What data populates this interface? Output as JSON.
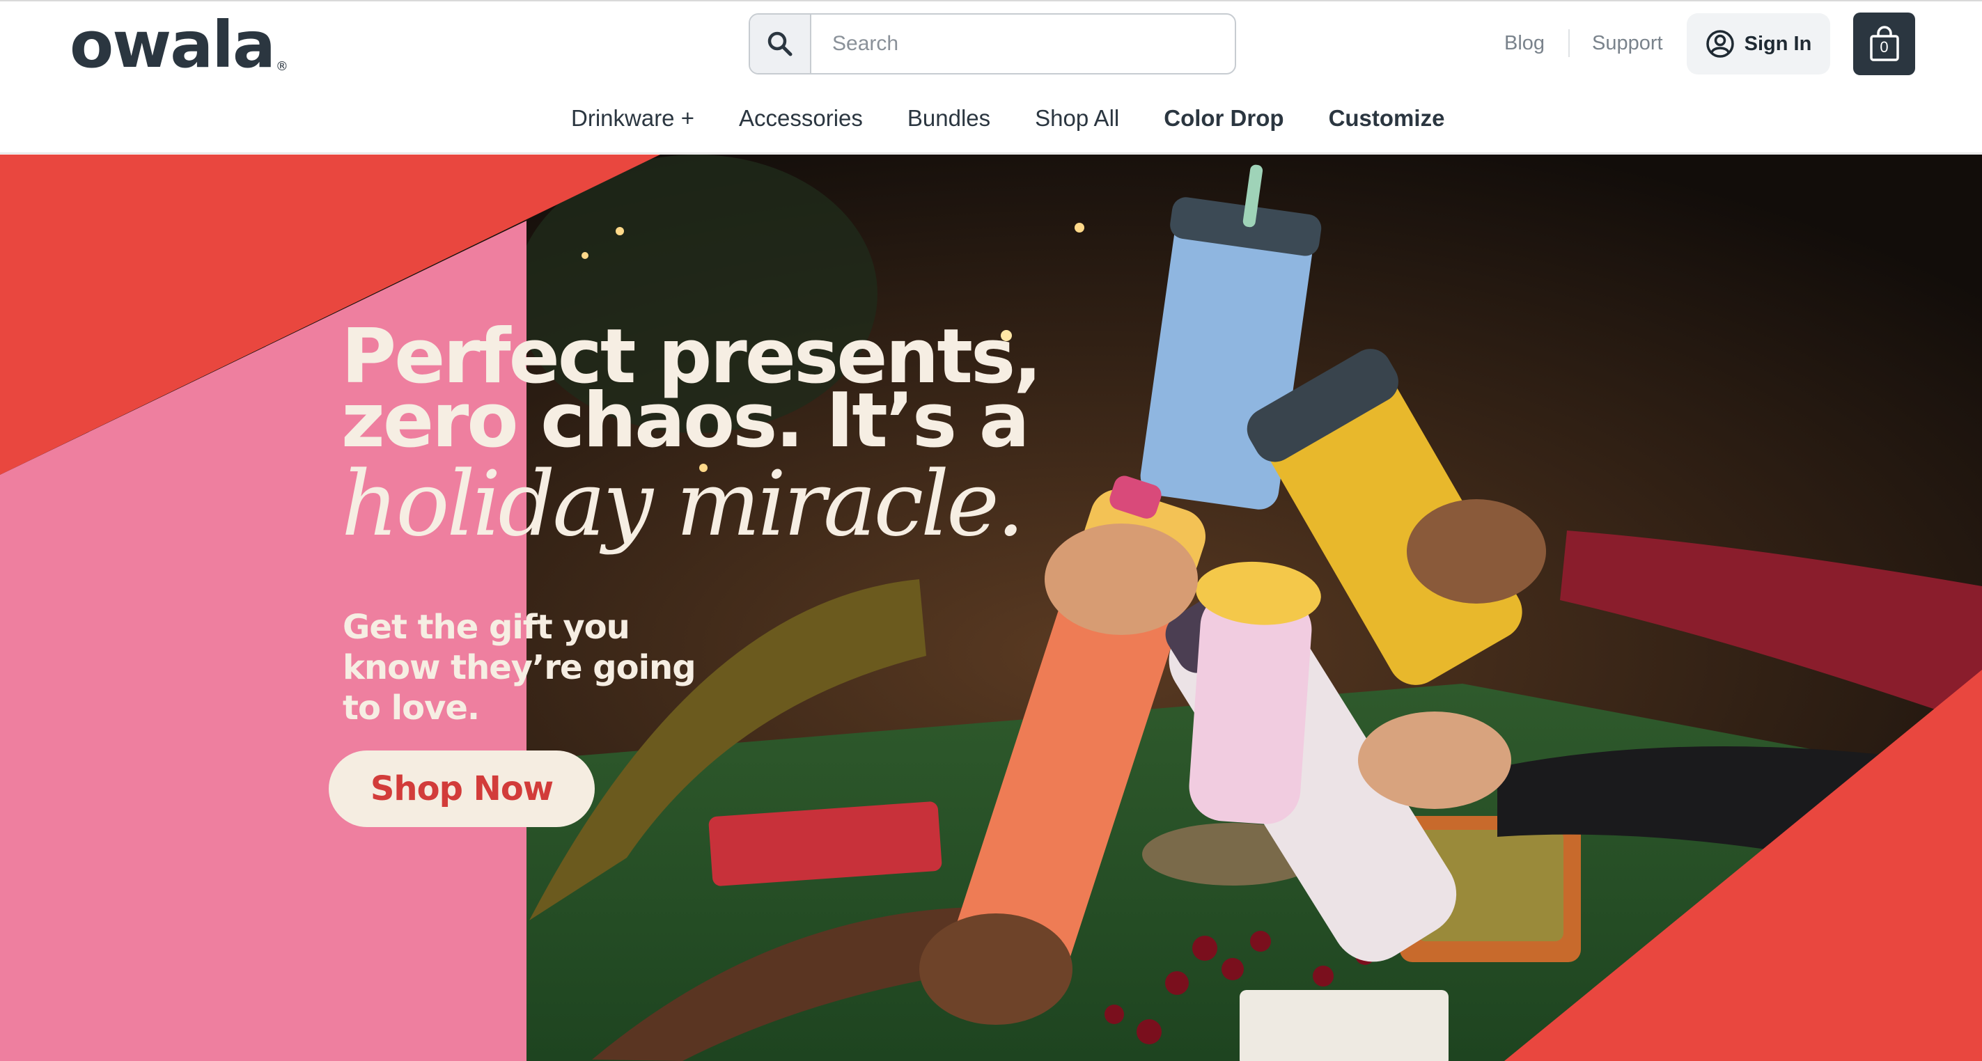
{
  "header": {
    "logo": "owala",
    "logo_mark": "®",
    "search": {
      "placeholder": "Search"
    },
    "links": {
      "blog": "Blog",
      "support": "Support"
    },
    "signin_label": "Sign In",
    "cart_count": "0"
  },
  "nav": {
    "items": [
      {
        "label": "Drinkware +"
      },
      {
        "label": "Accessories"
      },
      {
        "label": "Bundles"
      },
      {
        "label": "Shop All"
      },
      {
        "label": "Color Drop"
      },
      {
        "label": "Customize"
      }
    ]
  },
  "hero": {
    "headline_1": "Perfect presents,",
    "headline_2": "zero chaos. It’s a",
    "headline_script": "holiday miracle.",
    "subhead": "Get the gift you know they’re going to love.",
    "cta_label": "Shop Now"
  },
  "colors": {
    "brand_dark": "#2b3640",
    "hero_red": "#e9473f",
    "hero_pink": "#ee7f9f",
    "cream": "#f5ede1",
    "cta_text": "#d23c3a"
  }
}
